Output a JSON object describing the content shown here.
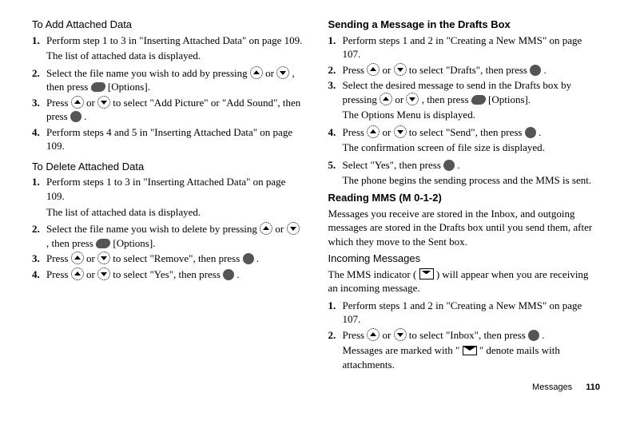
{
  "left": {
    "headingAdd": "To Add Attached Data",
    "addSteps": [
      {
        "num": "1.",
        "text": "Perform step 1 to 3 in \"Inserting Attached Data\" on page 109.",
        "sub": "The list of attached data is displayed."
      },
      {
        "num": "2.",
        "preUp": "Select the file name you wish to add by pressing ",
        "midOrDown": " or ",
        "postThen": ", then press ",
        "options": " [Options]."
      },
      {
        "num": "3.",
        "preUp": "Press ",
        "midOrDown": " or ",
        "sel": " to select \"Add Picture\" or \"Add Sound\", then press ",
        "dot": "."
      },
      {
        "num": "4.",
        "text": "Perform steps 4 and 5 in \"Inserting Attached Data\" on page 109."
      }
    ],
    "headingDel": "To Delete Attached Data",
    "delSteps": [
      {
        "num": "1.",
        "text": "Perform steps 1 to 3 in \"Inserting Attached Data\" on page 109.",
        "sub": "The list of attached data is displayed."
      },
      {
        "num": "2.",
        "pre": "Select the file name you wish to delete by pressing ",
        "midOrDown": " or ",
        "postThen": ", then press ",
        "options": " [Options]."
      },
      {
        "num": "3.",
        "preUp": "Press ",
        "midOrDown": " or ",
        "sel": " to select \"Remove\", then press ",
        "dot": "."
      },
      {
        "num": "4.",
        "preUp": "Press ",
        "midOrDown": " or ",
        "sel": " to select \"Yes\", then press ",
        "dot": "."
      }
    ]
  },
  "right": {
    "headingSend": "Sending a Message in the Drafts Box",
    "sendSteps": [
      {
        "num": "1.",
        "text": "Perform steps 1 and 2 in \"Creating a New MMS\" on page 107."
      },
      {
        "num": "2.",
        "preUp": "Press ",
        "midOrDown": " or ",
        "sel": " to select \"Drafts\", then press ",
        "dot": "."
      },
      {
        "num": "3.",
        "pre": "Select the desired message to send in the Drafts box by pressing ",
        "midOrDown": " or ",
        "postThen": ", then press ",
        "options": " [Options].",
        "sub": "The Options Menu is displayed."
      },
      {
        "num": "4.",
        "preUp": "Press ",
        "midOrDown": " or ",
        "sel": " to select \"Send\", then press ",
        "dot": ".",
        "sub": "The confirmation screen of file size is displayed."
      },
      {
        "num": "5.",
        "pre": "Select \"Yes\", then press ",
        "dot": ".",
        "sub": "The phone begins the sending process and the MMS is sent."
      }
    ],
    "headingRead": "Reading MMS (M 0-1-2)",
    "readBody": "Messages you receive are stored in the Inbox, and outgoing messages are stored in the Drafts box until you send them, after which they move to the Sent box.",
    "headingIncoming": "Incoming Messages",
    "incomingPre": "The MMS indicator (",
    "incomingPost": ") will appear when you are receiving an incoming message.",
    "incomingSteps": [
      {
        "num": "1.",
        "text": "Perform steps 1 and 2 in \"Creating a New MMS\" on page 107."
      },
      {
        "num": "2.",
        "preUp": "Press ",
        "midOrDown": " or ",
        "sel": " to select \"Inbox\", then press ",
        "dot": ".",
        "subPre": "Messages are marked with \"",
        "subPost": "\" denote mails with attachments."
      }
    ]
  },
  "footer": {
    "section": "Messages",
    "page": "110"
  }
}
